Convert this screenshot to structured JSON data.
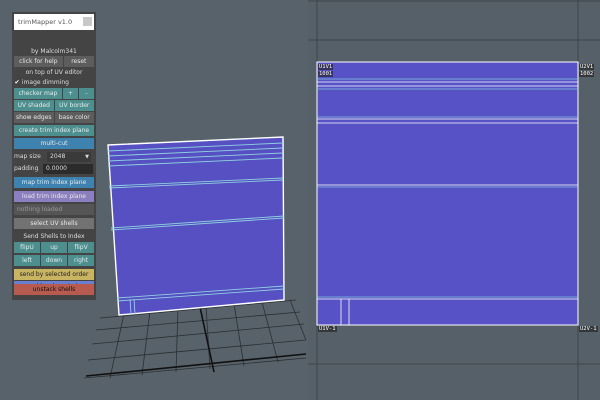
{
  "panel": {
    "title": "trimMapper v1.0",
    "author": "by Malcolm341",
    "help": "click for help",
    "reset": "reset",
    "on_top": "on top of UV editor",
    "dimming_check": "✔",
    "dimming": "image dimming",
    "checker_map": "checker map",
    "plus": "+",
    "minus": "-",
    "uv_shaded": "UV shaded",
    "uv_border": "UV border",
    "show_edges": "show edges",
    "base_color": "base color",
    "create_plane": "create trim index plane",
    "multi_cut": "multi-cut",
    "map_size_label": "map size",
    "map_size_value": "2048",
    "padding_label": "padding",
    "padding_value": "0.0000",
    "map_plane": "map trim index plane",
    "load_plane": "load trim index plane",
    "nothing_loaded": "nothing loaded",
    "select_shells": "select UV shells",
    "send_to_index": "Send Shells to Index",
    "flipU": "flipU",
    "up": "up",
    "flipV": "flipV",
    "left": "left",
    "down": "down",
    "right": "right",
    "send_selected": "send by selected order",
    "send_closest": "send by closest size",
    "unstack": "unstack shells"
  },
  "uv_editor": {
    "labels": {
      "u1v1": "U1V1",
      "t1001": "1001",
      "u2v1": "U2V1",
      "t1002": "1002",
      "u1vm1": "U1V-1",
      "u2vm1": "U2V-1"
    }
  },
  "colors": {
    "uv_fill": "#5a55c8",
    "uv_line": "#7ec8d8",
    "uv_border": "#ffffff"
  }
}
